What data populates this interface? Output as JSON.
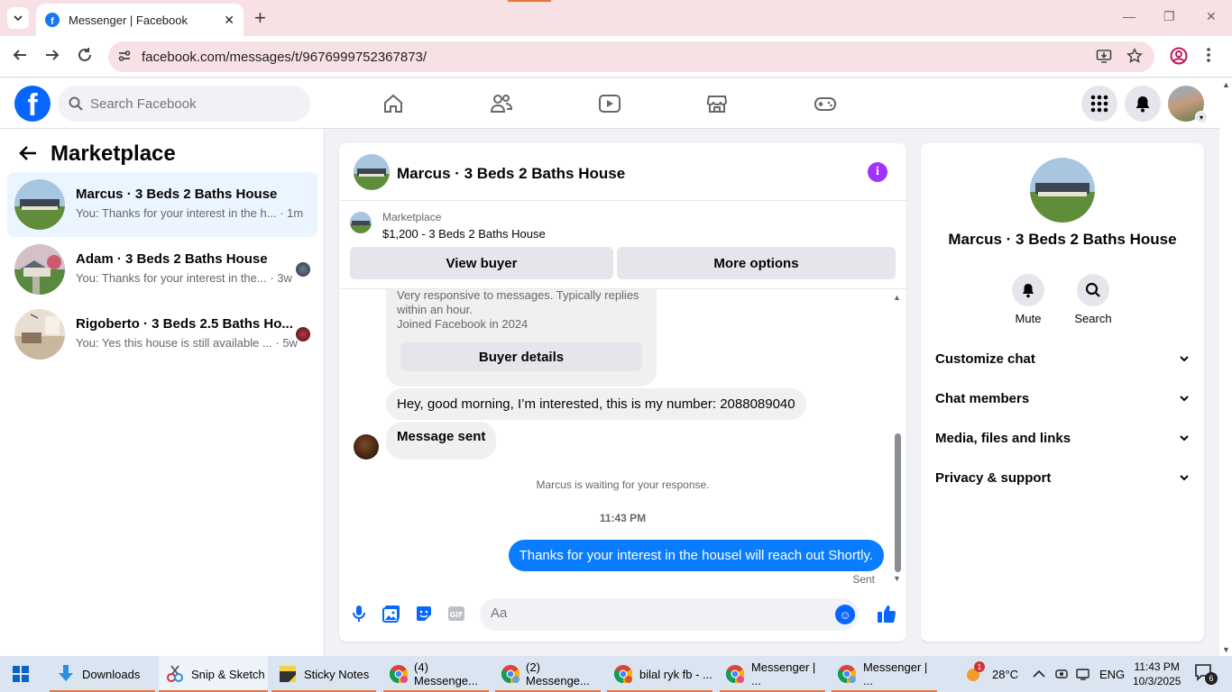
{
  "browser": {
    "tab_title": "Messenger | Facebook",
    "url": "facebook.com/messages/t/9676999752367873/"
  },
  "fb": {
    "search_placeholder": "Search Facebook"
  },
  "sidebar": {
    "title": "Marketplace",
    "conversations": [
      {
        "name": "Marcus · 3 Beds 2 Baths House",
        "snippet": "You: Thanks for your interest in the h... · 1m",
        "active": true
      },
      {
        "name": "Adam · 3 Beds 2 Baths House",
        "snippet": "You: Thanks for your interest in the... · 3w",
        "active": false
      },
      {
        "name": "Rigoberto · 3 Beds 2.5 Baths Ho...",
        "snippet": "You: Yes this house is still available ... · 5w",
        "active": false
      }
    ]
  },
  "chat": {
    "title": "Marcus · 3 Beds 2 Baths House",
    "listing_label": "Marketplace",
    "listing_price": "$1,200 - 3 Beds 2 Baths House",
    "view_buyer": "View buyer",
    "more_options": "More options",
    "card_line1": "Very responsive to messages. Typically replies",
    "card_line2": "within an hour.",
    "card_line3": "Joined Facebook in 2024",
    "buyer_details": "Buyer details",
    "msg_in_1": "Hey, good morning, I’m interested, this is my number: 2088089040",
    "msg_in_2": "Message sent",
    "waiting": "Marcus is waiting for your response.",
    "time": "11:43 PM",
    "msg_out": "Thanks for your interest in the housel will reach out Shortly.",
    "sent_label": "Sent",
    "composer_placeholder": "Aa"
  },
  "details": {
    "title": "Marcus · 3 Beds 2 Baths House",
    "mute": "Mute",
    "search": "Search",
    "sections": [
      "Customize chat",
      "Chat members",
      "Media, files and links",
      "Privacy & support"
    ]
  },
  "taskbar": {
    "items": [
      "Downloads",
      "Snip & Sketch",
      "Sticky Notes",
      "(4) Messenge...",
      "(2) Messenge...",
      "bilal ryk fb - ...",
      "Messenger | ...",
      "Messenger | ..."
    ],
    "temp": "28°C",
    "lang": "ENG",
    "time": "11:43 PM",
    "date": "10/3/2025",
    "weather_badge": "1",
    "notif_count": "6"
  }
}
